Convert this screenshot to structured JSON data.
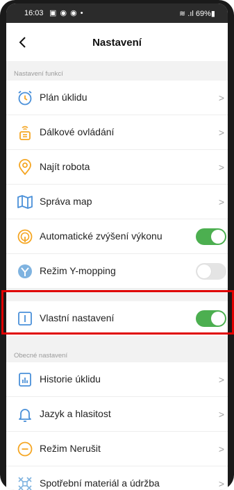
{
  "status_bar": {
    "time": "16:03",
    "icons": "▣ ◉ ◉ •",
    "right": "≋ .ıl 69%▮"
  },
  "header": {
    "title": "Nastavení"
  },
  "sections": [
    {
      "title": "Nastavení funkcí",
      "items": [
        {
          "label": "Plán úklidu",
          "icon": "alarm-clock-icon",
          "control": "chevron",
          "chevron": ">"
        },
        {
          "label": "Dálkové ovládání",
          "icon": "remote-control-icon",
          "control": "chevron",
          "chevron": ">"
        },
        {
          "label": "Najít robota",
          "icon": "location-pin-icon",
          "control": "chevron",
          "chevron": ">"
        },
        {
          "label": "Správa map",
          "icon": "map-icon",
          "control": "chevron",
          "chevron": ">"
        },
        {
          "label": "Automatické zvýšení výkonu",
          "icon": "power-boost-icon",
          "control": "toggle",
          "state": "on"
        },
        {
          "label": "Režim Y-mopping",
          "icon": "y-mopping-icon",
          "control": "toggle",
          "state": "off"
        },
        {
          "label": "Vlastní nastavení",
          "icon": "custom-settings-icon",
          "control": "toggle",
          "state": "on"
        }
      ]
    },
    {
      "title": "Obecné nastavení",
      "items": [
        {
          "label": "Historie úklidu",
          "icon": "cleaning-history-icon",
          "control": "chevron",
          "chevron": ">"
        },
        {
          "label": "Jazyk a hlasitost",
          "icon": "bell-icon",
          "control": "chevron",
          "chevron": ">"
        },
        {
          "label": "Režim Nerušit",
          "icon": "do-not-disturb-icon",
          "control": "chevron",
          "chevron": ">"
        },
        {
          "label": "Spotřební materiál a údržba",
          "icon": "consumables-icon",
          "control": "chevron",
          "chevron": ">"
        }
      ]
    }
  ],
  "colors": {
    "accent_orange": "#f5a623",
    "icon_blue": "#4a90d9",
    "toggle_on": "#4caf50",
    "toggle_off": "#e4e4e4",
    "highlight": "#e00000"
  }
}
